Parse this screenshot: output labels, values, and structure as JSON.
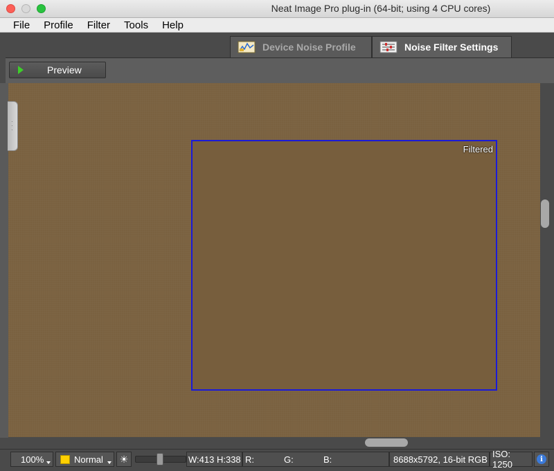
{
  "window": {
    "title": "Neat Image Pro plug-in (64-bit; using 4 CPU cores)"
  },
  "menu": {
    "items": [
      "File",
      "Profile",
      "Filter",
      "Tools",
      "Help"
    ]
  },
  "tabs": {
    "device_noise_profile": "Device Noise Profile",
    "noise_filter_settings": "Noise Filter Settings",
    "active": "Noise Filter Settings"
  },
  "toolbar": {
    "preview_label": "Preview"
  },
  "viewer": {
    "filtered_label": "Filtered",
    "image_color": "#7a6140",
    "selection_color": "#1a1ad8"
  },
  "status": {
    "zoom": "100%",
    "mode": "Normal",
    "width": "W:413",
    "height": "H:338",
    "r_label": "R:",
    "g_label": "G:",
    "b_label": "B:",
    "resolution": "8688x5792, 16-bit RGB",
    "iso": "ISO: 1250",
    "brightness_level": 0.5
  }
}
